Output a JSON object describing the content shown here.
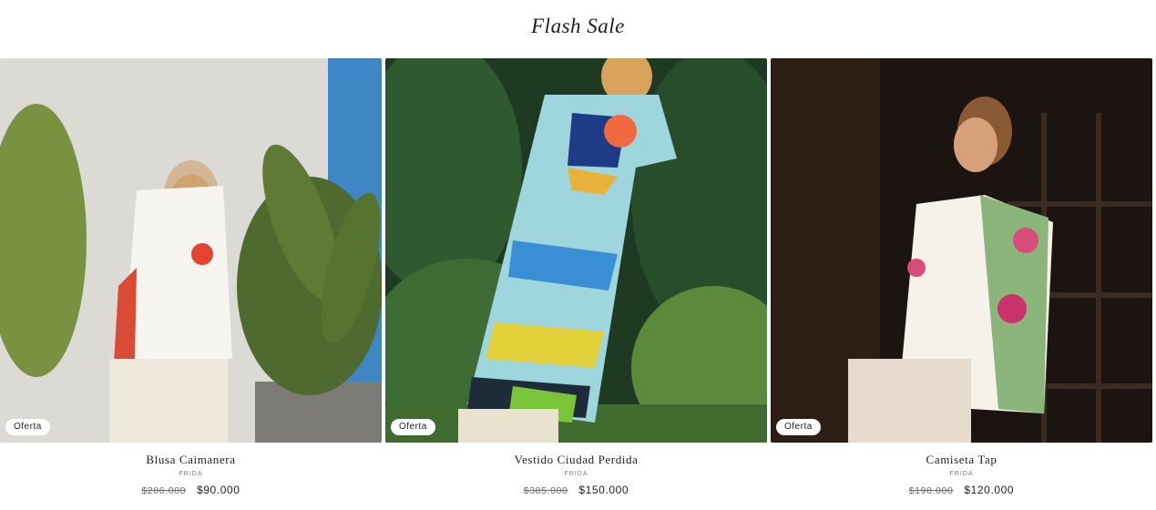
{
  "section": {
    "title": "Flash Sale"
  },
  "products": [
    {
      "title": "Blusa Caimanera",
      "vendor": "FRIDA",
      "compare_price": "$286.000",
      "price": "$90.000",
      "badge": "Oferta"
    },
    {
      "title": "Vestido Ciudad Perdida",
      "vendor": "FRIDA",
      "compare_price": "$385.000",
      "price": "$150.000",
      "badge": "Oferta"
    },
    {
      "title": "Camiseta Tap",
      "vendor": "FRIDA",
      "compare_price": "$198.000",
      "price": "$120.000",
      "badge": "Oferta"
    }
  ]
}
